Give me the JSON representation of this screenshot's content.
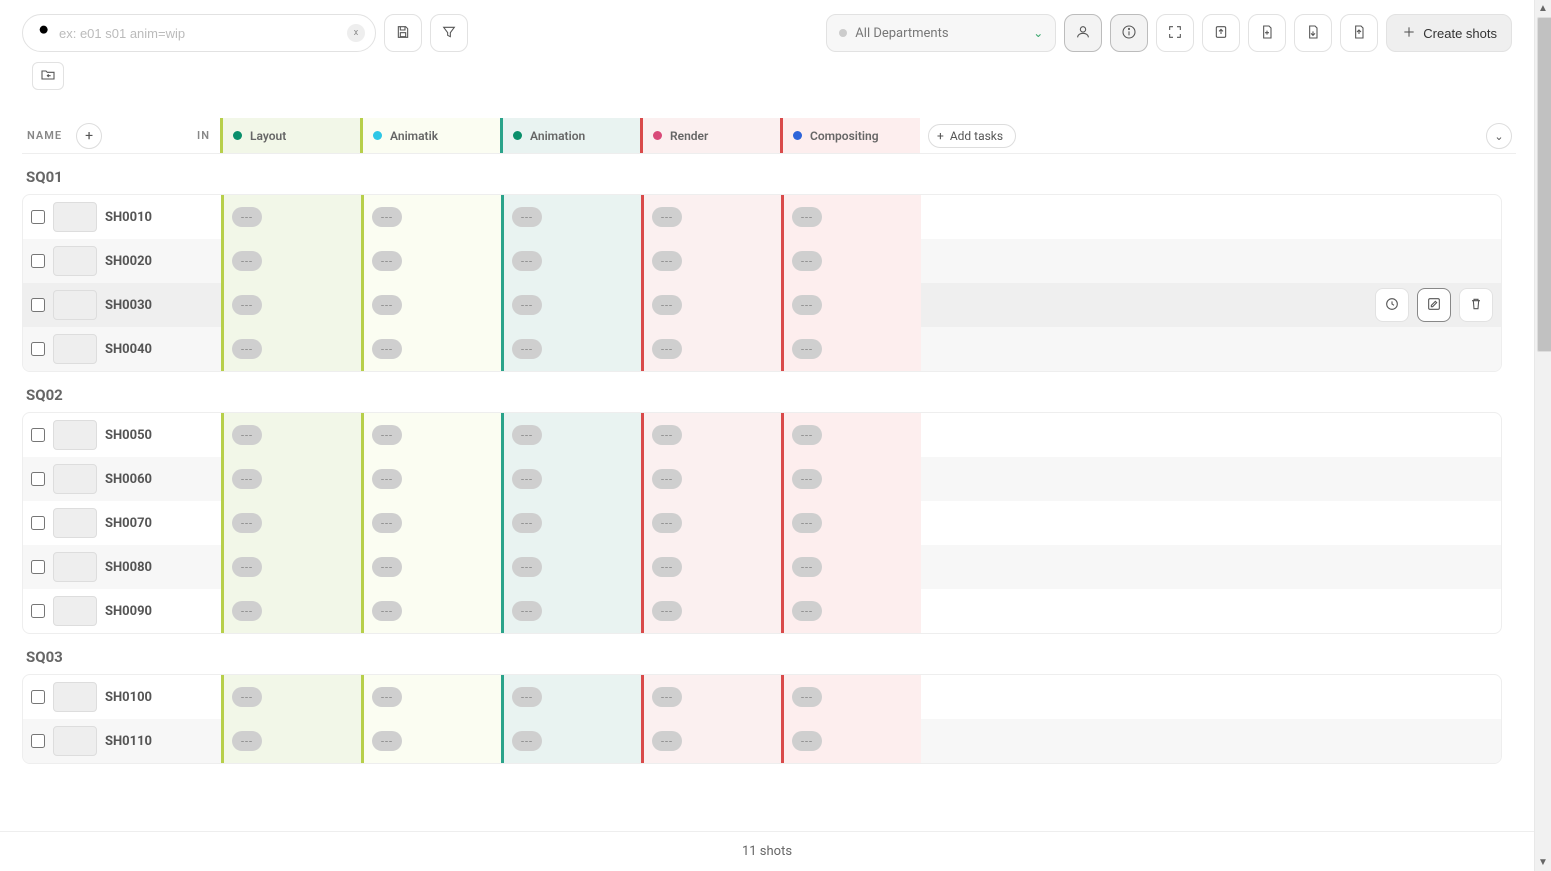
{
  "search": {
    "placeholder": "ex: e01 s01 anim=wip",
    "clear_label": "x"
  },
  "department_filter": {
    "label": "All Departments"
  },
  "create_button": "Create shots",
  "header": {
    "name_label": "NAME",
    "in_label": "IN",
    "add_tasks_label": "Add tasks"
  },
  "task_columns": [
    {
      "label": "Layout",
      "dot": "#0a8f6b",
      "border": "#b7cf4a",
      "bg": "#f2f7e8"
    },
    {
      "label": "Animatik",
      "dot": "#2ec7e6",
      "border": "#b7cf4a",
      "bg": "#fbfdf2"
    },
    {
      "label": "Animation",
      "dot": "#0a8f6b",
      "border": "#2aa38a",
      "bg": "#e9f3f1"
    },
    {
      "label": "Render",
      "dot": "#d94a79",
      "border": "#d94a4a",
      "bg": "#fbf0f0"
    },
    {
      "label": "Compositing",
      "dot": "#2e64d9",
      "border": "#d94a4a",
      "bg": "#fdeeee"
    }
  ],
  "empty_status": "---",
  "sequences": [
    {
      "name": "SQ01",
      "shots": [
        {
          "name": "SH0010",
          "hovered": false
        },
        {
          "name": "SH0020",
          "hovered": false
        },
        {
          "name": "SH0030",
          "hovered": true
        },
        {
          "name": "SH0040",
          "hovered": false
        }
      ]
    },
    {
      "name": "SQ02",
      "shots": [
        {
          "name": "SH0050",
          "hovered": false
        },
        {
          "name": "SH0060",
          "hovered": false
        },
        {
          "name": "SH0070",
          "hovered": false
        },
        {
          "name": "SH0080",
          "hovered": false
        },
        {
          "name": "SH0090",
          "hovered": false
        }
      ]
    },
    {
      "name": "SQ03",
      "shots": [
        {
          "name": "SH0100",
          "hovered": false
        },
        {
          "name": "SH0110",
          "hovered": false
        }
      ]
    }
  ],
  "footer": {
    "count_text": "11 shots"
  }
}
